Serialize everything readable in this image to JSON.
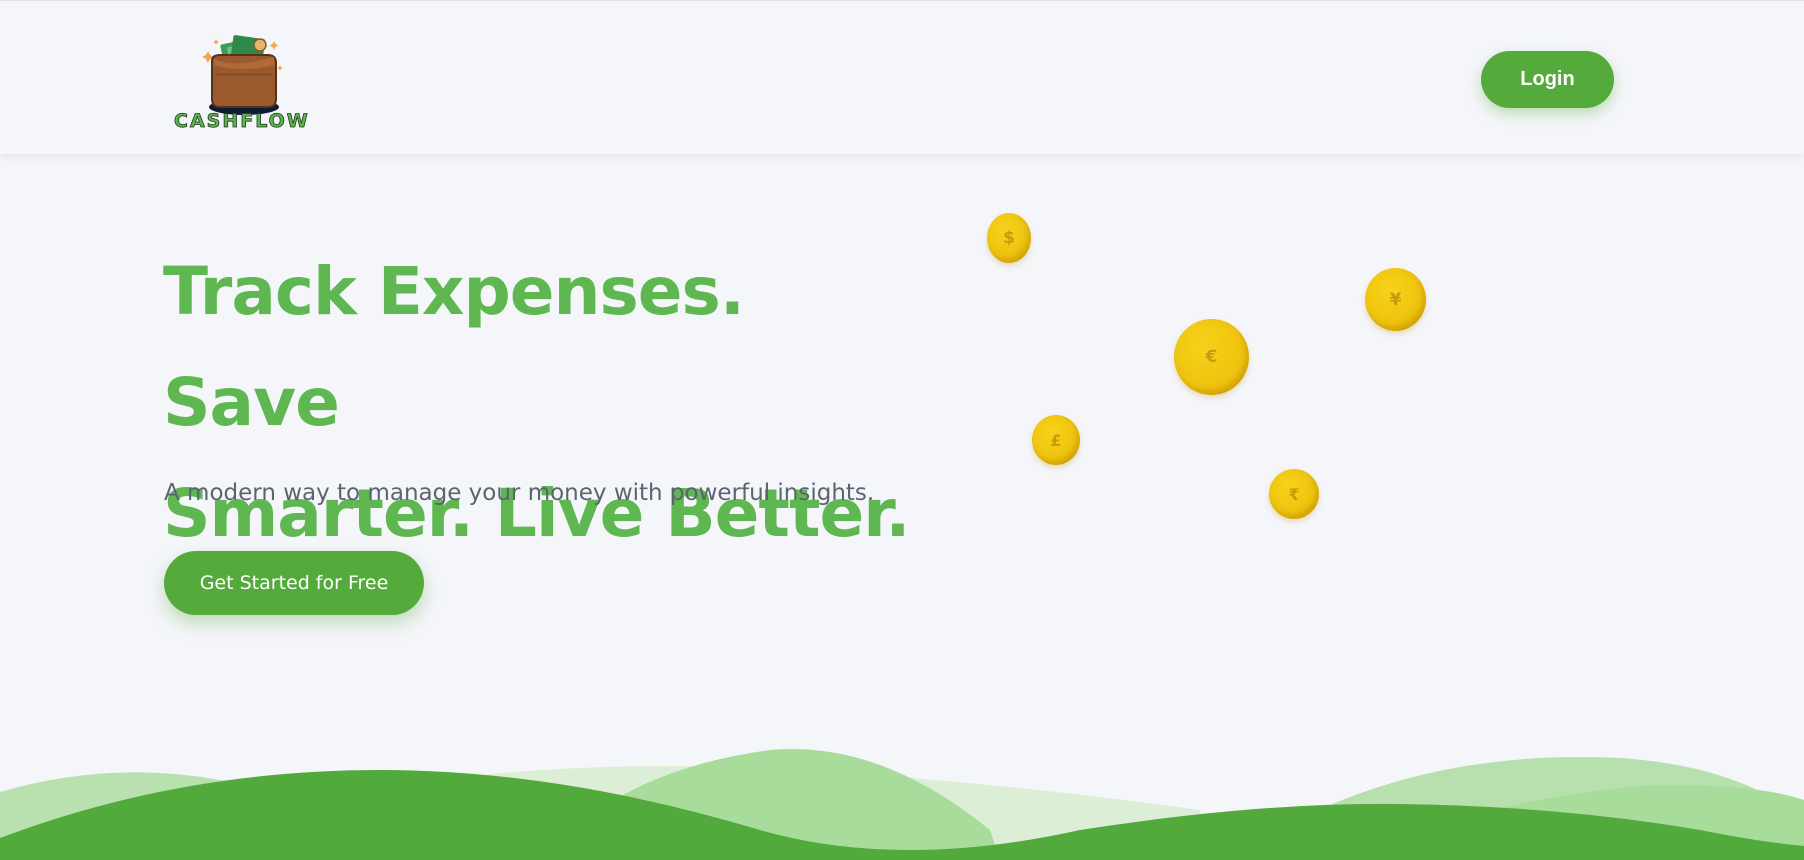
{
  "brand": {
    "name": "CASHFLOW",
    "logo_icon": "wallet-with-cash-icon",
    "accent": "#55aa3c"
  },
  "header": {
    "login_label": "Login"
  },
  "hero": {
    "title_line1": "Track Expenses. Save",
    "title_line2": "Smarter. Live Better.",
    "subtitle": "A modern way to manage your money with powerful insights.",
    "cta_label": "Get Started for Free"
  },
  "coins": [
    {
      "symbol": "$",
      "name": "dollar-coin-icon"
    },
    {
      "symbol": "¥",
      "name": "yen-coin-icon"
    },
    {
      "symbol": "€",
      "name": "euro-coin-icon"
    },
    {
      "symbol": "£",
      "name": "pound-coin-icon"
    },
    {
      "symbol": "₹",
      "name": "rupee-coin-icon"
    }
  ],
  "colors": {
    "background": "#f5f6fa",
    "title_green": "#5fb751",
    "coin_gold": "#efc30e",
    "wave_dark": "#52aa3c",
    "wave_light": "#b7e0ae"
  }
}
